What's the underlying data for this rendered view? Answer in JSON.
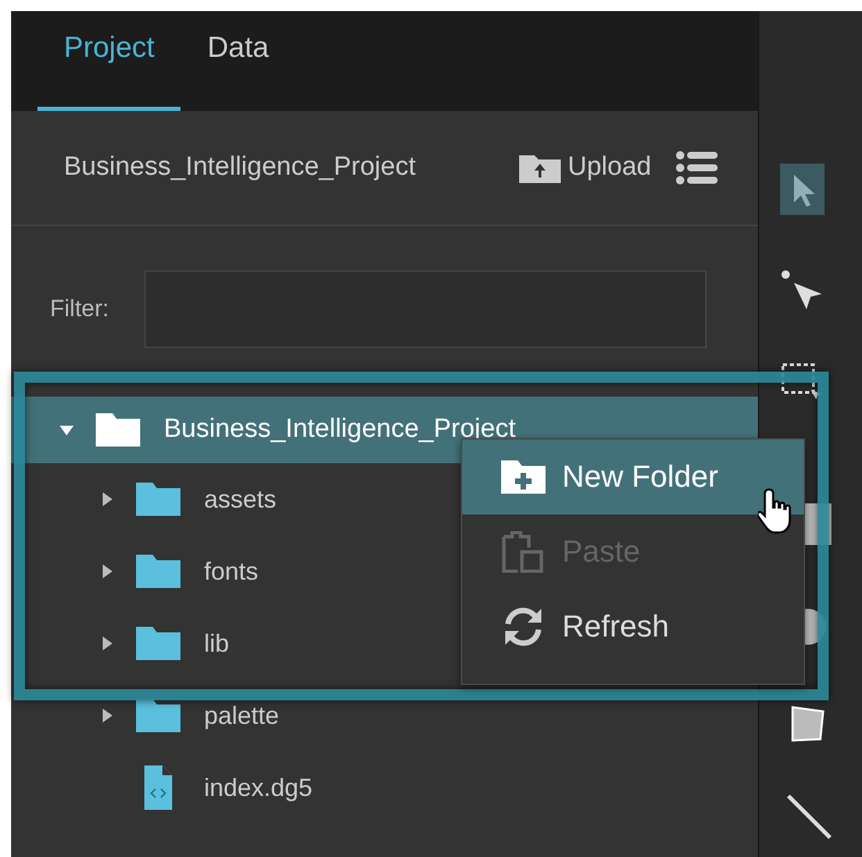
{
  "tabs": [
    {
      "label": "Project",
      "selected": true
    },
    {
      "label": "Data",
      "selected": false
    }
  ],
  "header": {
    "project_name": "Business_Intelligence_Project",
    "upload_label": "Upload"
  },
  "filter": {
    "label": "Filter:"
  },
  "tree": [
    {
      "label": "Business_Intelligence_Project",
      "kind": "folder",
      "expanded": true,
      "selected": true,
      "children": [
        {
          "label": "assets",
          "kind": "folder",
          "expanded": false,
          "selected": false
        },
        {
          "label": "fonts",
          "kind": "folder",
          "expanded": false,
          "selected": false
        },
        {
          "label": "lib",
          "kind": "folder",
          "expanded": false,
          "selected": false
        },
        {
          "label": "palette",
          "kind": "folder",
          "expanded": false,
          "selected": false
        },
        {
          "label": "index.dg5",
          "kind": "file",
          "selected": false
        }
      ]
    }
  ],
  "context_menu": [
    {
      "label": "New Folder",
      "kind": "new-folder",
      "selected": true,
      "disabled": false
    },
    {
      "label": "Paste",
      "kind": "paste",
      "selected": false,
      "disabled": true
    },
    {
      "label": "Refresh",
      "kind": "refresh",
      "selected": false,
      "disabled": false
    }
  ],
  "tools": [
    {
      "kind": "pointer",
      "selected": true
    },
    {
      "kind": "node",
      "selected": false
    },
    {
      "kind": "marquee",
      "selected": false
    },
    {
      "kind": "rect",
      "selected": false
    },
    {
      "kind": "ellipse",
      "selected": false
    },
    {
      "kind": "polygon",
      "selected": false
    },
    {
      "kind": "line",
      "selected": false
    }
  ]
}
